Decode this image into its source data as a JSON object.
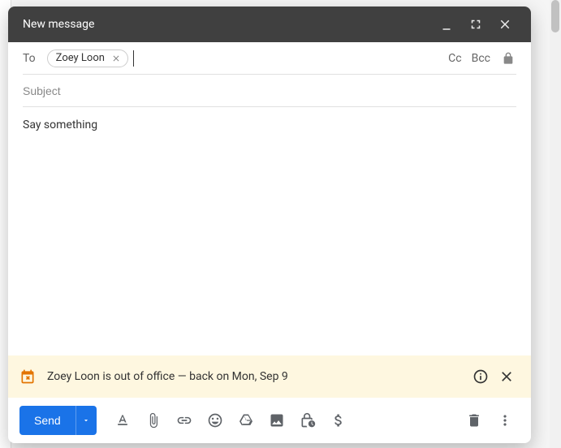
{
  "titlebar": {
    "title": "New message"
  },
  "to": {
    "label": "To",
    "chips": [
      {
        "name": "Zoey Loon"
      }
    ],
    "cc_label": "Cc",
    "bcc_label": "Bcc"
  },
  "subject": {
    "placeholder": "Subject",
    "value": ""
  },
  "body": {
    "text": "Say something"
  },
  "banner": {
    "text": "Zoey Loon is out of office — back on Mon, Sep 9"
  },
  "toolbar": {
    "send_label": "Send"
  }
}
